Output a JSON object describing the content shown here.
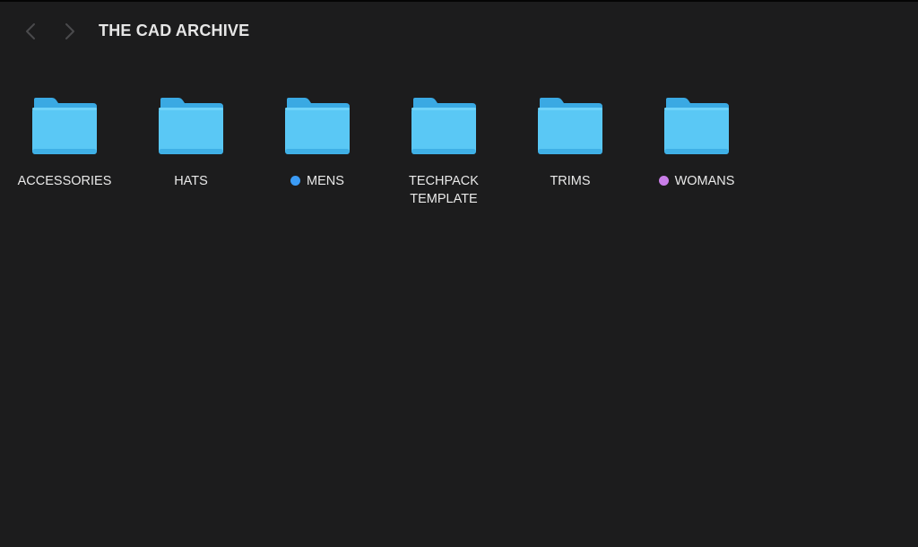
{
  "window": {
    "title": "THE CAD ARCHIVE"
  },
  "toolbar": {
    "back_icon": "chevron-left-icon",
    "forward_icon": "chevron-right-icon"
  },
  "colors": {
    "background": "#1c1c1d",
    "folder_body": "#5ac8f5",
    "folder_tab": "#3aa9e3",
    "tag_blue": "#3b9bf5",
    "tag_purple": "#c97ee8"
  },
  "folders": [
    {
      "label": "ACCESSORIES",
      "icon": "folder-icon",
      "tag": null
    },
    {
      "label": "HATS",
      "icon": "folder-icon",
      "tag": null
    },
    {
      "label": "MENS",
      "icon": "folder-icon",
      "tag": "blue"
    },
    {
      "label": "TECHPACK\nTEMPLATE",
      "icon": "folder-icon",
      "tag": null
    },
    {
      "label": "TRIMS",
      "icon": "folder-icon",
      "tag": null
    },
    {
      "label": "WOMANS",
      "icon": "folder-icon",
      "tag": "purple"
    }
  ]
}
